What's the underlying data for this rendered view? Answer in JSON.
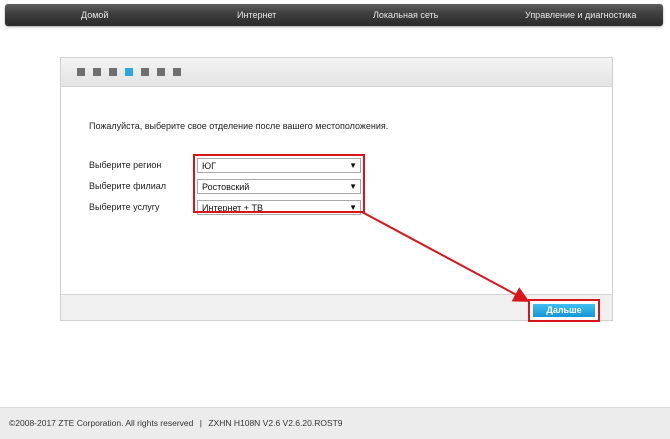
{
  "nav": {
    "items": [
      {
        "label": "Домой"
      },
      {
        "label": "Интернет"
      },
      {
        "label": "Локальная сеть"
      },
      {
        "label": "Управление и диагностика"
      }
    ]
  },
  "wizard": {
    "steps_total": 7,
    "active_step": 4,
    "intro": "Пожалуйста, выберите свое отделение после вашего местоположения.",
    "fields": {
      "region": {
        "label": "Выберите регион",
        "value": "ЮГ"
      },
      "branch": {
        "label": "Выберите филиал",
        "value": "Ростовский"
      },
      "service": {
        "label": "Выберите услугу",
        "value": "Интернет + ТВ"
      }
    },
    "arrow_glyph": "▼",
    "next_label": "Дальше"
  },
  "footer": {
    "copyright": "©2008-2017 ZTE Corporation. All rights reserved",
    "separator": "|",
    "version": "ZXHN H108N V2.6 V2.6.20.ROST9"
  },
  "colors": {
    "accent": "#2aa7e0",
    "annotation": "#d8151b",
    "nav_bg": "#3e3e3e"
  }
}
